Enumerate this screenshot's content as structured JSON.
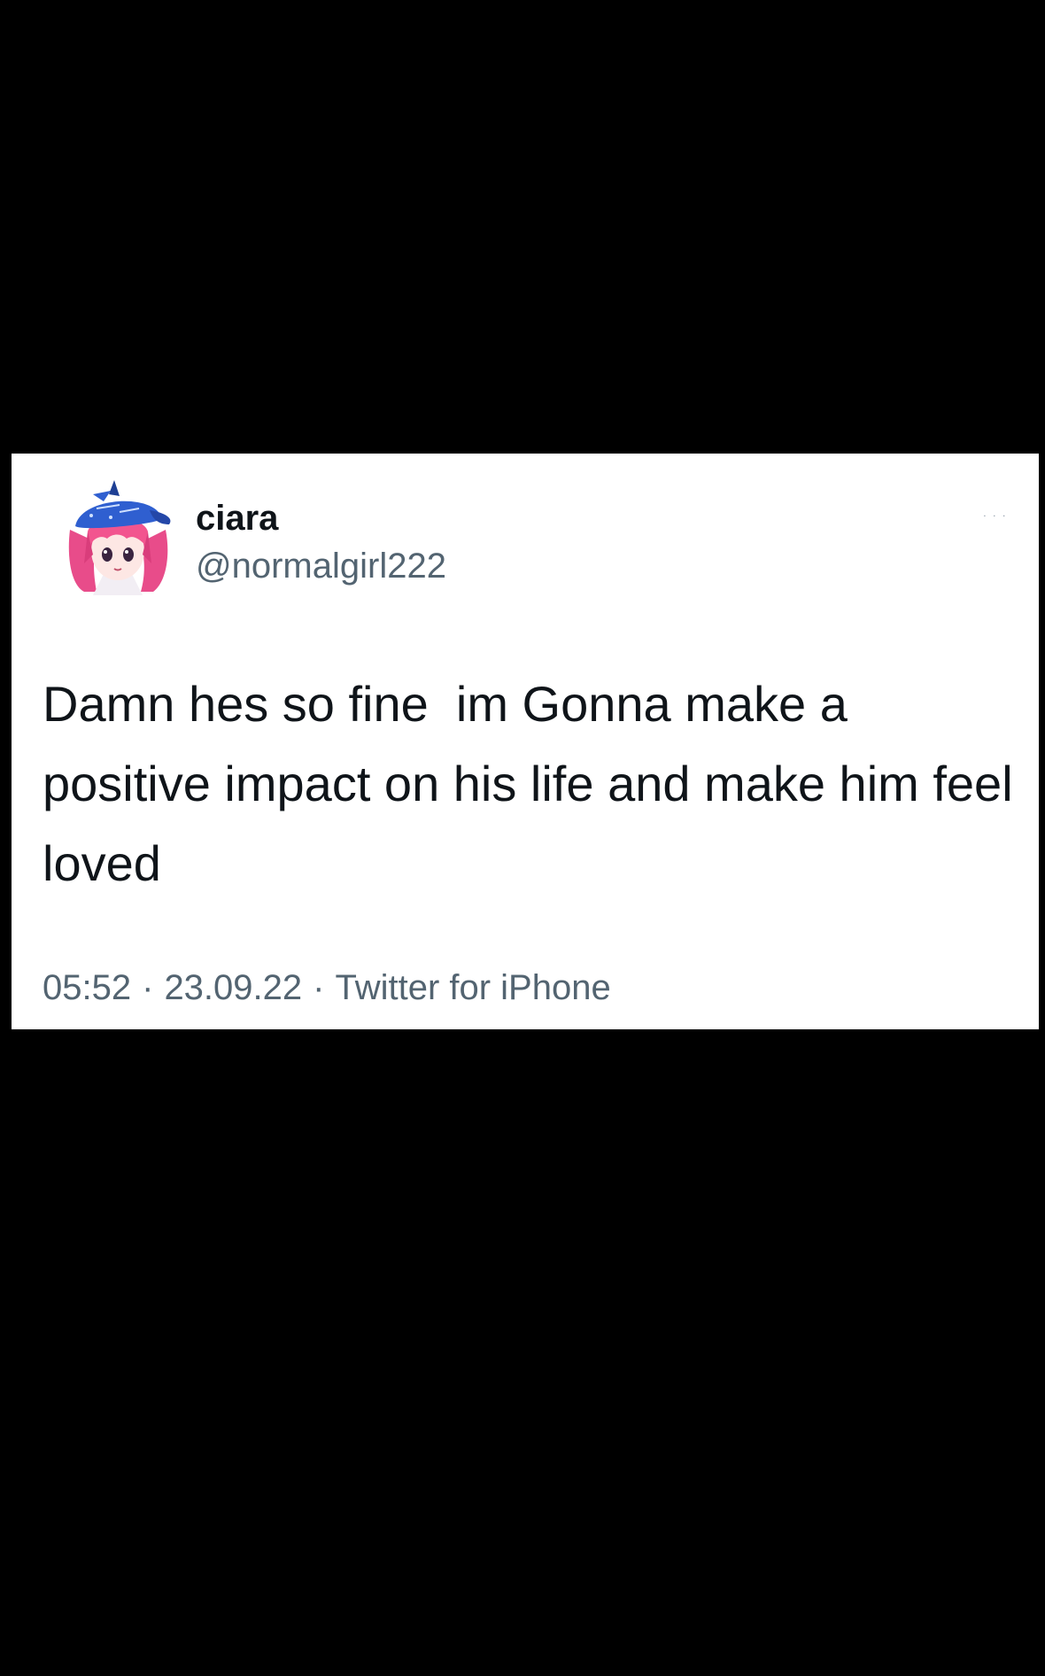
{
  "tweet": {
    "display_name": "ciara",
    "handle": "@normalgirl222",
    "text": "Damn hes so fine  im Gonna make a positive impact on his life and make him feel loved",
    "time": "05:52",
    "date": "23.09.22",
    "source": "Twitter for iPhone",
    "separator": "·",
    "avatar_icon": "anime-girl-avatar-icon",
    "more_icon": "more-options-icon"
  },
  "colors": {
    "background": "#000000",
    "card": "#ffffff",
    "text_primary": "#0f1419",
    "text_secondary": "#536471",
    "avatar_hair": "#e84c8a",
    "avatar_cap": "#2f5fd0"
  }
}
